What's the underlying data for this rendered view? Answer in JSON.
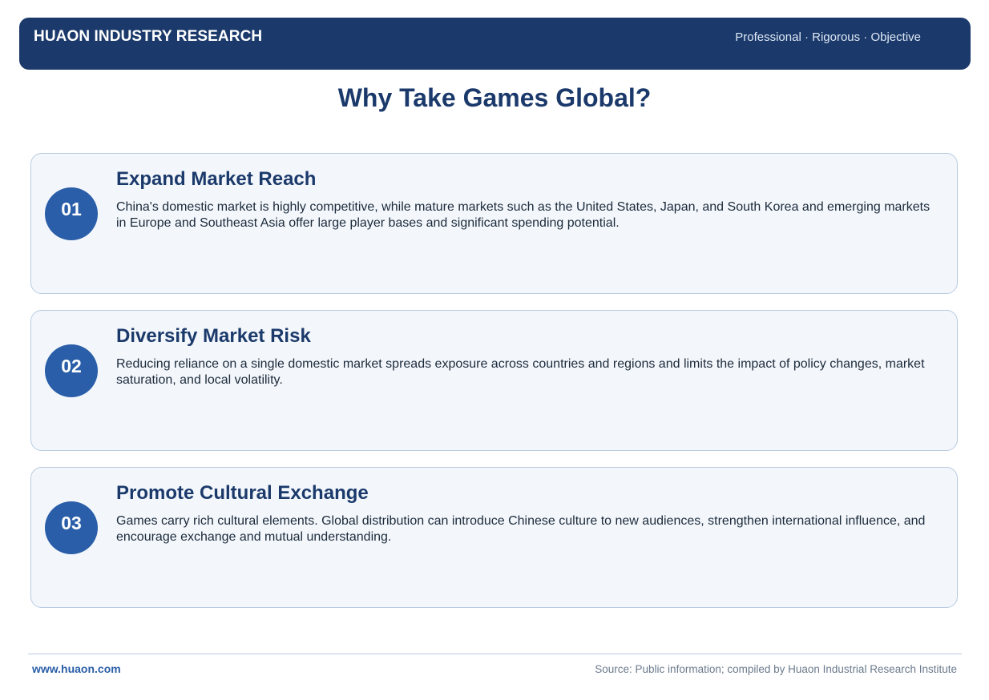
{
  "header": {
    "brand": "HUAON INDUSTRY RESEARCH",
    "tagline": "Professional · Rigorous · Objective"
  },
  "title": "Why Take Games Global?",
  "cards": [
    {
      "number": "01",
      "title": "Expand Market Reach",
      "text": "China's domestic market is highly competitive, while mature markets such as the United States, Japan, and South Korea and emerging markets in Europe and Southeast Asia offer large player bases and significant spending potential."
    },
    {
      "number": "02",
      "title": "Diversify Market Risk",
      "text": "Reducing reliance on a single domestic market spreads exposure across countries and regions and limits the impact of policy changes, market saturation, and local volatility."
    },
    {
      "number": "03",
      "title": "Promote Cultural Exchange",
      "text": "Games carry rich cultural elements. Global distribution can introduce Chinese culture to new audiences, strengthen international influence, and encourage exchange and mutual understanding."
    }
  ],
  "footer": {
    "website": "www.huaon.com",
    "source": "Source: Public information; compiled by Huaon Industrial Research Institute"
  },
  "colors": {
    "primary": "#1b3a6b",
    "accent": "#2a5ea8",
    "card_background": "#f3f7fc",
    "card_border": "#b8cbe0"
  }
}
